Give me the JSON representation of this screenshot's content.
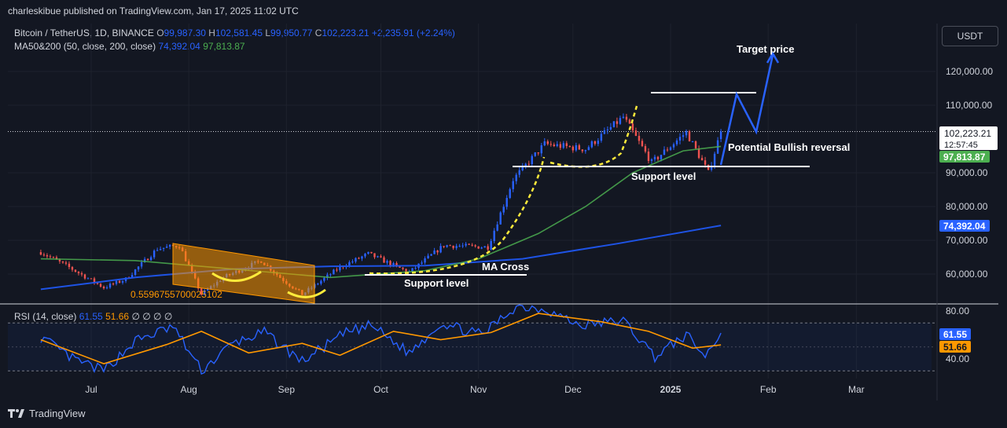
{
  "publisher": "charleskibue published on TradingView.com, Jan 17, 2025 11:02 UTC",
  "legend": {
    "symbol": "Bitcoin / TetherUS, 1D, BINANCE",
    "o_label": "O",
    "o": "99,987.30",
    "h_label": "H",
    "h": "102,581.45",
    "l_label": "L",
    "l": "99,950.77",
    "c_label": "C",
    "c": "102,223.21",
    "change": "+2,235.91 (+2.24%)",
    "ma_label": "MA50&200 (50, close, 200, close)",
    "ma_value1": "74,392.04",
    "ma_value2": "97,813.87"
  },
  "rsi_legend": {
    "label": "RSI (14, close)",
    "value1": "61.55",
    "value2": "51.66",
    "extra": "∅ ∅ ∅ ∅"
  },
  "currency_button": "USDT",
  "brand": "TradingView",
  "colors": {
    "background": "#131722",
    "up": "#2962ff",
    "down": "#ef5350",
    "ma50": "#4caf50",
    "ma200": "#1e53e5",
    "rsi": "#2962ff",
    "rsi_ma": "#ff9800",
    "annotation_yellow": "#ffeb3b",
    "annotation_orange": "#ff9800"
  },
  "chart_data": [
    {
      "type": "candlestick",
      "title": "Bitcoin / TetherUS, 1D, BINANCE",
      "y_ticks": [
        "120,000.00",
        "110,000.00",
        "90,000.00",
        "80,000.00",
        "70,000.00",
        "60,000.00"
      ],
      "x_ticks": [
        "Jul",
        "Aug",
        "Sep",
        "Oct",
        "Nov",
        "Dec",
        "2025",
        "Feb",
        "Mar"
      ],
      "ylim": [
        53000,
        130000
      ],
      "price_path": [
        {
          "date": "2024-06-15",
          "close": 66500
        },
        {
          "date": "2024-06-24",
          "close": 62000
        },
        {
          "date": "2024-07-05",
          "close": 56000
        },
        {
          "date": "2024-07-12",
          "close": 58500
        },
        {
          "date": "2024-07-22",
          "close": 67500
        },
        {
          "date": "2024-07-29",
          "close": 68500
        },
        {
          "date": "2024-08-05",
          "close": 54000
        },
        {
          "date": "2024-08-12",
          "close": 59000
        },
        {
          "date": "2024-08-24",
          "close": 64000
        },
        {
          "date": "2024-08-30",
          "close": 59000
        },
        {
          "date": "2024-09-06",
          "close": 54000
        },
        {
          "date": "2024-09-18",
          "close": 62000
        },
        {
          "date": "2024-09-27",
          "close": 66000
        },
        {
          "date": "2024-10-10",
          "close": 60500
        },
        {
          "date": "2024-10-21",
          "close": 68500
        },
        {
          "date": "2024-11-04",
          "close": 68000
        },
        {
          "date": "2024-11-12",
          "close": 88000
        },
        {
          "date": "2024-11-22",
          "close": 98500
        },
        {
          "date": "2024-12-05",
          "close": 97000
        },
        {
          "date": "2024-12-17",
          "close": 106500
        },
        {
          "date": "2024-12-26",
          "close": 93000
        },
        {
          "date": "2025-01-06",
          "close": 102000
        },
        {
          "date": "2025-01-13",
          "close": 90000
        },
        {
          "date": "2025-01-17",
          "close": 102223
        }
      ],
      "series": [
        {
          "name": "MA50",
          "last": 97813.87,
          "points": [
            {
              "date": "2024-06-15",
              "value": 64500
            },
            {
              "date": "2024-07-15",
              "value": 64000
            },
            {
              "date": "2024-08-15",
              "value": 61500
            },
            {
              "date": "2024-09-15",
              "value": 59000
            },
            {
              "date": "2024-10-15",
              "value": 61000
            },
            {
              "date": "2024-11-01",
              "value": 64500
            },
            {
              "date": "2024-11-20",
              "value": 72000
            },
            {
              "date": "2024-12-05",
              "value": 80000
            },
            {
              "date": "2024-12-20",
              "value": 90000
            },
            {
              "date": "2025-01-05",
              "value": 96500
            },
            {
              "date": "2025-01-17",
              "value": 97813.87
            }
          ]
        },
        {
          "name": "MA200",
          "last": 74392.04,
          "points": [
            {
              "date": "2024-06-15",
              "value": 55500
            },
            {
              "date": "2024-07-15",
              "value": 59000
            },
            {
              "date": "2024-08-15",
              "value": 61500
            },
            {
              "date": "2024-09-15",
              "value": 62300
            },
            {
              "date": "2024-10-15",
              "value": 62500
            },
            {
              "date": "2024-11-15",
              "value": 64500
            },
            {
              "date": "2024-12-15",
              "value": 69000
            },
            {
              "date": "2025-01-17",
              "value": 74392.04
            }
          ]
        }
      ],
      "price_labels": {
        "last_price": "102,223.21",
        "countdown": "12:57:45",
        "ma50": "97,813.87",
        "ma200": "74,392.04"
      },
      "annotations": {
        "target_price": "Target price",
        "bullish_reversal": "Potential Bullish reversal",
        "support_upper": "Support level",
        "support_lower": "Support level",
        "ma_cross": "MA Cross",
        "fib_value": "0.5596755700025102"
      }
    },
    {
      "type": "line",
      "title": "RSI (14, close)",
      "y_ticks": [
        "80.00",
        "40.00"
      ],
      "ylim": [
        25,
        88
      ],
      "series": [
        {
          "name": "RSI",
          "last": 61.55,
          "points": [
            {
              "date": "2024-06-15",
              "value": 58
            },
            {
              "date": "2024-06-25",
              "value": 40
            },
            {
              "date": "2024-07-05",
              "value": 30
            },
            {
              "date": "2024-07-15",
              "value": 55
            },
            {
              "date": "2024-07-27",
              "value": 67
            },
            {
              "date": "2024-08-05",
              "value": 30
            },
            {
              "date": "2024-08-15",
              "value": 53
            },
            {
              "date": "2024-08-25",
              "value": 62
            },
            {
              "date": "2024-09-06",
              "value": 38
            },
            {
              "date": "2024-09-20",
              "value": 62
            },
            {
              "date": "2024-09-28",
              "value": 68
            },
            {
              "date": "2024-10-10",
              "value": 45
            },
            {
              "date": "2024-10-20",
              "value": 70
            },
            {
              "date": "2024-11-02",
              "value": 60
            },
            {
              "date": "2024-11-13",
              "value": 84
            },
            {
              "date": "2024-11-22",
              "value": 82
            },
            {
              "date": "2024-12-03",
              "value": 68
            },
            {
              "date": "2024-12-17",
              "value": 72
            },
            {
              "date": "2024-12-27",
              "value": 42
            },
            {
              "date": "2025-01-06",
              "value": 60
            },
            {
              "date": "2025-01-12",
              "value": 42
            },
            {
              "date": "2025-01-17",
              "value": 61.55
            }
          ]
        },
        {
          "name": "RSI-based MA",
          "last": 51.66,
          "points": [
            {
              "date": "2024-06-15",
              "value": 56
            },
            {
              "date": "2024-07-05",
              "value": 36
            },
            {
              "date": "2024-07-25",
              "value": 52
            },
            {
              "date": "2024-08-05",
              "value": 63
            },
            {
              "date": "2024-08-20",
              "value": 45
            },
            {
              "date": "2024-09-06",
              "value": 53
            },
            {
              "date": "2024-09-18",
              "value": 43
            },
            {
              "date": "2024-10-05",
              "value": 63
            },
            {
              "date": "2024-10-20",
              "value": 56
            },
            {
              "date": "2024-11-05",
              "value": 62
            },
            {
              "date": "2024-11-20",
              "value": 78
            },
            {
              "date": "2024-12-10",
              "value": 71
            },
            {
              "date": "2024-12-25",
              "value": 63
            },
            {
              "date": "2025-01-08",
              "value": 49
            },
            {
              "date": "2025-01-17",
              "value": 51.66
            }
          ]
        }
      ],
      "price_labels": {
        "rsi": "61.55",
        "rsi_ma": "51.66"
      }
    }
  ]
}
